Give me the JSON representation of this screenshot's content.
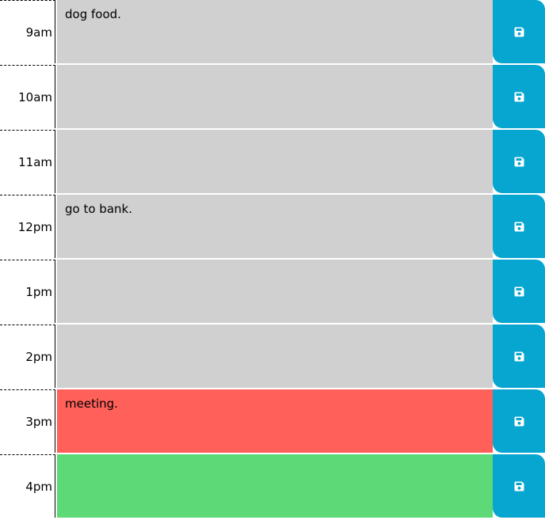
{
  "planner": {
    "rows": [
      {
        "hour": "9am",
        "text": "dog food.",
        "status": "past"
      },
      {
        "hour": "10am",
        "text": "",
        "status": "past"
      },
      {
        "hour": "11am",
        "text": "",
        "status": "past"
      },
      {
        "hour": "12pm",
        "text": "go to bank.",
        "status": "past"
      },
      {
        "hour": "1pm",
        "text": "",
        "status": "past"
      },
      {
        "hour": "2pm",
        "text": "",
        "status": "past"
      },
      {
        "hour": "3pm",
        "text": "meeting.",
        "status": "present"
      },
      {
        "hour": "4pm",
        "text": "",
        "status": "future"
      }
    ],
    "save_icon": "floppy-disk-icon"
  },
  "colors": {
    "past": "#d0d0d0",
    "present": "#ff605a",
    "future": "#5ed978",
    "save_button": "#06a6d1"
  }
}
